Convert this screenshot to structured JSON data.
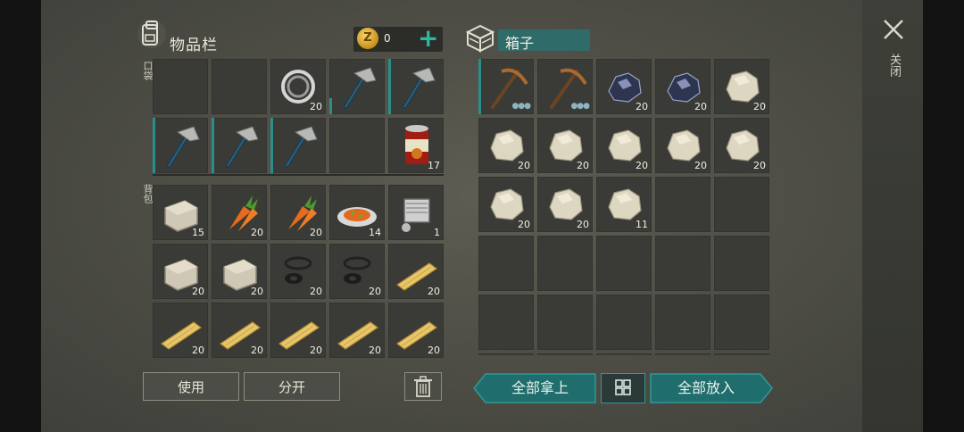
{
  "inventory": {
    "title": "物品栏",
    "coins": "0",
    "coin_symbol": "Z",
    "pocket_label": "口袋",
    "backpack_label": "背包",
    "pocket_slots": [
      {
        "icon": "",
        "count": ""
      },
      {
        "icon": "",
        "count": ""
      },
      {
        "icon": "bearing-icon",
        "count": "20"
      },
      {
        "icon": "stone-hatchet-icon",
        "count": "",
        "selected": "half"
      },
      {
        "icon": "stone-hatchet-icon",
        "count": "",
        "selected": "full"
      },
      {
        "icon": "stone-hatchet-icon",
        "count": "",
        "selected": "full"
      },
      {
        "icon": "stone-hatchet-icon",
        "count": "",
        "selected": "full"
      },
      {
        "icon": "stone-hatchet-icon",
        "count": "",
        "selected": "full"
      },
      {
        "icon": "",
        "count": ""
      },
      {
        "icon": "canned-food-icon",
        "count": "17"
      }
    ],
    "backpack_slots": [
      {
        "icon": "stone-block-icon",
        "count": "15"
      },
      {
        "icon": "carrot-icon",
        "count": "20"
      },
      {
        "icon": "carrot-icon",
        "count": "20"
      },
      {
        "icon": "carrot-dish-icon",
        "count": "14"
      },
      {
        "icon": "engine-icon",
        "count": "1"
      },
      {
        "icon": "stone-block-icon",
        "count": "20"
      },
      {
        "icon": "stone-block-icon",
        "count": "20"
      },
      {
        "icon": "gasket-icon",
        "count": "20"
      },
      {
        "icon": "gasket-icon",
        "count": "20"
      },
      {
        "icon": "wood-plank-icon",
        "count": "20"
      },
      {
        "icon": "wood-plank-icon",
        "count": "20"
      },
      {
        "icon": "wood-plank-icon",
        "count": "20"
      },
      {
        "icon": "wood-plank-icon",
        "count": "20"
      },
      {
        "icon": "wood-plank-icon",
        "count": "20"
      },
      {
        "icon": "wood-plank-icon",
        "count": "20"
      }
    ],
    "use_label": "使用",
    "split_label": "分开"
  },
  "box": {
    "title": "箱子",
    "slots": [
      {
        "icon": "pickaxe-icon",
        "count": "",
        "dots": "●●●",
        "selected": "full"
      },
      {
        "icon": "pickaxe-icon",
        "count": "",
        "dots": "●●●"
      },
      {
        "icon": "iron-ore-icon",
        "count": "20"
      },
      {
        "icon": "iron-ore-icon",
        "count": "20"
      },
      {
        "icon": "stone-icon",
        "count": "20"
      },
      {
        "icon": "stone-icon",
        "count": "20"
      },
      {
        "icon": "stone-icon",
        "count": "20"
      },
      {
        "icon": "stone-icon",
        "count": "20"
      },
      {
        "icon": "stone-icon",
        "count": "20"
      },
      {
        "icon": "stone-icon",
        "count": "20"
      },
      {
        "icon": "stone-icon",
        "count": "20"
      },
      {
        "icon": "stone-icon",
        "count": "20"
      },
      {
        "icon": "stone-icon",
        "count": "11"
      },
      {
        "icon": "",
        "count": ""
      },
      {
        "icon": "",
        "count": ""
      },
      {
        "icon": "",
        "count": ""
      },
      {
        "icon": "",
        "count": ""
      },
      {
        "icon": "",
        "count": ""
      },
      {
        "icon": "",
        "count": ""
      },
      {
        "icon": "",
        "count": ""
      },
      {
        "icon": "",
        "count": ""
      },
      {
        "icon": "",
        "count": ""
      },
      {
        "icon": "",
        "count": ""
      },
      {
        "icon": "",
        "count": ""
      },
      {
        "icon": "",
        "count": ""
      },
      {
        "icon": "",
        "count": ""
      },
      {
        "icon": "",
        "count": ""
      },
      {
        "icon": "",
        "count": ""
      },
      {
        "icon": "",
        "count": ""
      },
      {
        "icon": "",
        "count": ""
      }
    ],
    "take_all_label": "全部拿上",
    "put_all_label": "全部放入"
  },
  "close_label": "关闭",
  "colors": {
    "accent": "#2a8e8b",
    "teal_button": "#1f6d6d",
    "plus": "#2cb9a4"
  }
}
